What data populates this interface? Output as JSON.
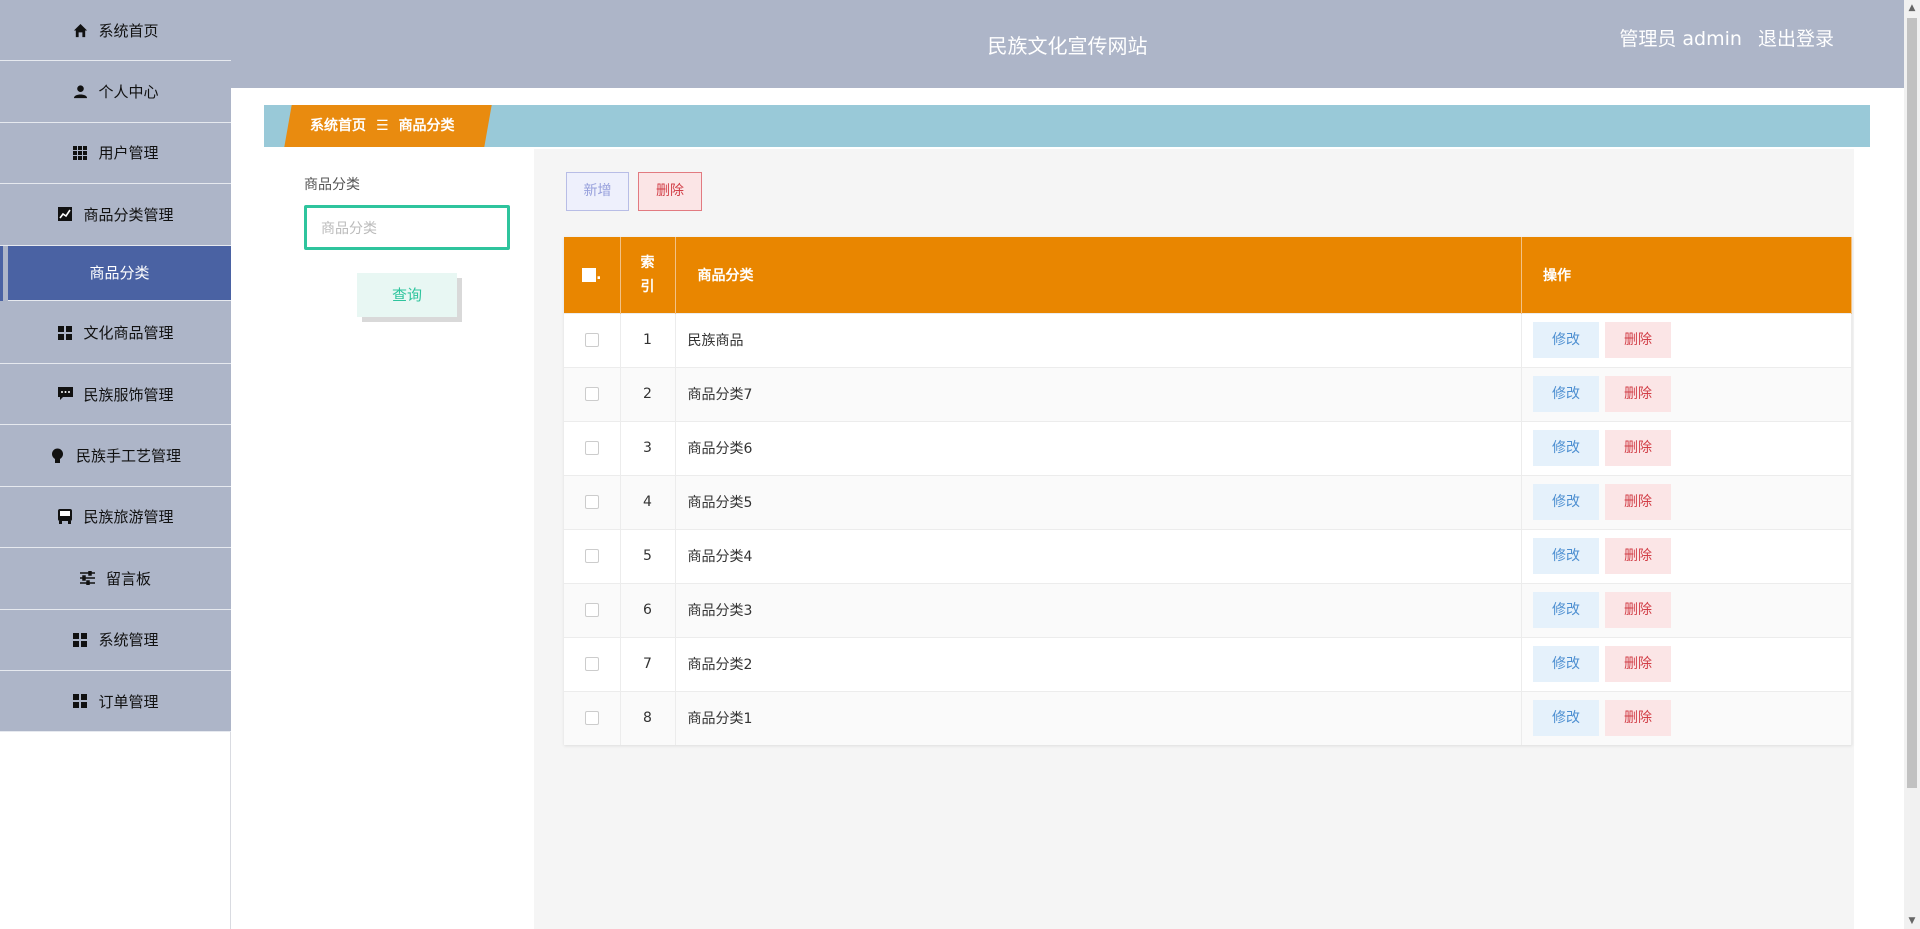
{
  "header": {
    "site_title": "民族文化宣传网站",
    "user_role": "管理员 admin",
    "logout": "退出登录"
  },
  "sidebar": {
    "items": [
      {
        "label": "系统首页",
        "icon": "home-icon"
      },
      {
        "label": "个人中心",
        "icon": "user-icon"
      },
      {
        "label": "用户管理",
        "icon": "grid-icon"
      },
      {
        "label": "商品分类管理",
        "icon": "chart-icon"
      },
      {
        "label": "商品分类",
        "icon": "",
        "active": true
      },
      {
        "label": "文化商品管理",
        "icon": "apps-icon"
      },
      {
        "label": "民族服饰管理",
        "icon": "comment-icon"
      },
      {
        "label": "民族手工艺管理",
        "icon": "bulb-icon"
      },
      {
        "label": "民族旅游管理",
        "icon": "bus-icon"
      },
      {
        "label": "留言板",
        "icon": "sliders-icon"
      },
      {
        "label": "系统管理",
        "icon": "apps-icon"
      },
      {
        "label": "订单管理",
        "icon": "apps-icon"
      }
    ]
  },
  "breadcrumb": {
    "home": "系统首页",
    "separator": "☰",
    "current": "商品分类"
  },
  "search": {
    "label": "商品分类",
    "placeholder": "商品分类",
    "query_button": "查询"
  },
  "toolbar": {
    "add": "新增",
    "delete": "删除"
  },
  "table": {
    "headers": {
      "index": "索引",
      "name": "商品分类",
      "operation": "操作"
    },
    "edit_label": "修改",
    "delete_label": "删除",
    "rows": [
      {
        "index": "1",
        "name": "民族商品"
      },
      {
        "index": "2",
        "name": "商品分类7"
      },
      {
        "index": "3",
        "name": "商品分类6"
      },
      {
        "index": "4",
        "name": "商品分类5"
      },
      {
        "index": "5",
        "name": "商品分类4"
      },
      {
        "index": "6",
        "name": "商品分类3"
      },
      {
        "index": "7",
        "name": "商品分类2"
      },
      {
        "index": "8",
        "name": "商品分类1"
      }
    ]
  },
  "colors": {
    "header_bg": "#adb5c8",
    "active_menu": "#4a62a3",
    "accent_orange": "#e98600",
    "crumb_bar": "#99c9d8",
    "search_border": "#2ec49d"
  }
}
